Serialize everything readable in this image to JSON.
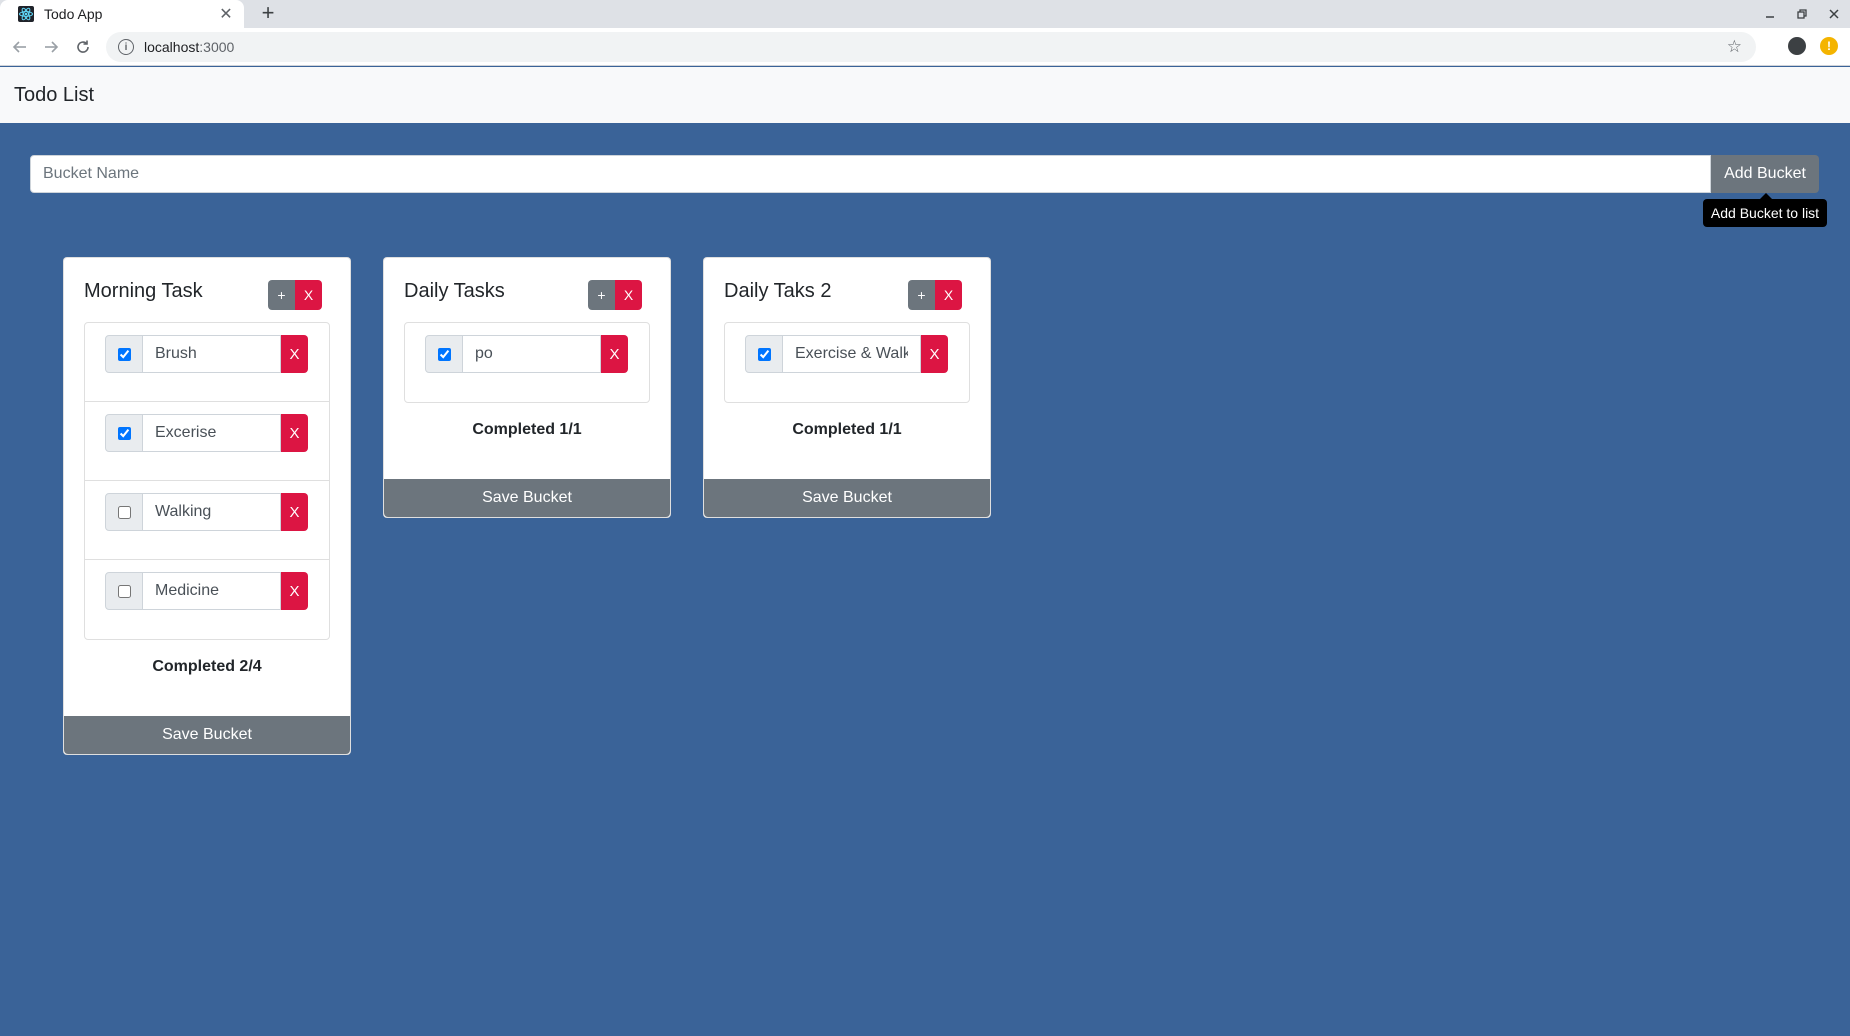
{
  "browser": {
    "tab_title": "Todo App",
    "new_tab_label": "+",
    "url_host": "localhost",
    "url_port": ":3000"
  },
  "app": {
    "title": "Todo List"
  },
  "add_bucket": {
    "placeholder": "Bucket Name",
    "value": "",
    "button_label": "Add Bucket",
    "tooltip": "Add Bucket to list"
  },
  "buckets": [
    {
      "name": "Morning Task",
      "add_label": "+",
      "delete_label": "X",
      "tasks": [
        {
          "text": "Brush",
          "done": true,
          "delete_label": "X"
        },
        {
          "text": "Excerise",
          "done": true,
          "delete_label": "X"
        },
        {
          "text": "Walking",
          "done": false,
          "delete_label": "X"
        },
        {
          "text": "Medicine",
          "done": false,
          "delete_label": "X"
        }
      ],
      "completed": "Completed 2/4",
      "save_label": "Save Bucket"
    },
    {
      "name": "Daily Tasks",
      "add_label": "+",
      "delete_label": "X",
      "tasks": [
        {
          "text": "po",
          "done": true,
          "delete_label": "X"
        }
      ],
      "completed": "Completed 1/1",
      "save_label": "Save Bucket"
    },
    {
      "name": "Daily Taks 2",
      "add_label": "+",
      "delete_label": "X",
      "tasks": [
        {
          "text": "Exercise & Walk",
          "done": true,
          "delete_label": "X"
        }
      ],
      "completed": "Completed 1/1",
      "save_label": "Save Bucket"
    }
  ],
  "colors": {
    "background": "#3a6398",
    "secondary": "#6c757d",
    "danger": "#dc1543"
  }
}
